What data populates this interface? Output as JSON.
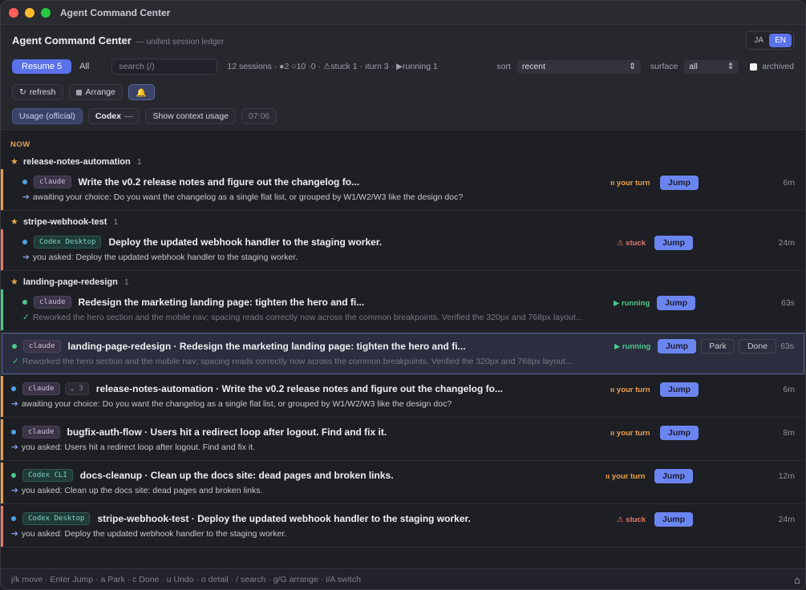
{
  "window": {
    "title": "Agent Command Center"
  },
  "header": {
    "app_name": "Agent Command Center",
    "app_sub": "— unified session ledger",
    "lang": [
      "JA",
      "EN"
    ],
    "resume_label": "Resume 5",
    "all_label": "All",
    "search_placeholder": "search (/)",
    "stats": "12 sessions · ●2 ○10 ·0 · ⚠stuck 1 · ıturn 3 · ▶running 1",
    "sort_label": "sort",
    "sort_value": "recent",
    "surface_label": "surface",
    "surface_value": "all",
    "archived_label": "archived",
    "refresh_label": "refresh",
    "arrange_label": "Arrange",
    "usage_label": "Usage (official)",
    "codex_label": "Codex",
    "codex_value": "—",
    "context_label": "Show context usage",
    "time": "07:06"
  },
  "section_label": "NOW",
  "groups": [
    {
      "name": "release-notes-automation",
      "count": "1"
    },
    {
      "name": "stripe-webhook-test",
      "count": "1"
    },
    {
      "name": "landing-page-redesign",
      "count": "1"
    }
  ],
  "items": [
    {
      "badge": "claude",
      "title": "Write the v0.2 release notes and figure out the changelog fo...",
      "status": "ıı your turn",
      "detail": "awaiting your choice: Do you want the changelog as a single flat list, or grouped by W1/W2/W3 like the design doc?",
      "age": "6m"
    },
    {
      "badge": "Codex Desktop",
      "title": "Deploy the updated webhook handler to the staging worker.",
      "status": "⚠ stuck",
      "detail": "you asked: Deploy the updated webhook handler to the staging worker.",
      "age": "24m"
    },
    {
      "badge": "claude",
      "title": "Redesign the marketing landing page: tighten the hero and fi...",
      "status": "▶ running",
      "detail": "Reworked the hero section and the mobile nav; spacing reads correctly now across the common breakpoints. Verified the 320px and 768px layout...",
      "age": "63s"
    },
    {
      "badge": "claude",
      "title": "landing-page-redesign · Redesign the marketing landing page: tighten the hero and fi...",
      "status": "▶ running",
      "detail": "Reworked the hero section and the mobile nav; spacing reads correctly now across the common breakpoints. Verified the 320px and 768px layout...",
      "age": "63s",
      "park": "Park",
      "done": "Done"
    },
    {
      "badge": "claude",
      "count": "3",
      "title": "release-notes-automation · Write the v0.2 release notes and figure out the changelog fo...",
      "status": "ıı your turn",
      "detail": "awaiting your choice: Do you want the changelog as a single flat list, or grouped by W1/W2/W3 like the design doc?",
      "age": "6m"
    },
    {
      "badge": "claude",
      "title": "bugfix-auth-flow · Users hit a redirect loop after logout. Find and fix it.",
      "status": "ıı your turn",
      "detail": "you asked: Users hit a redirect loop after logout. Find and fix it.",
      "age": "8m"
    },
    {
      "badge": "Codex CLI",
      "title": "docs-cleanup · Clean up the docs site: dead pages and broken links.",
      "status": "ıı your turn",
      "detail": "you asked: Clean up the docs site: dead pages and broken links.",
      "age": "12m"
    },
    {
      "badge": "Codex Desktop",
      "title": "stripe-webhook-test · Deploy the updated webhook handler to the staging worker.",
      "status": "⚠ stuck",
      "detail": "you asked: Deploy the updated webhook handler to the staging worker.",
      "age": "24m"
    }
  ],
  "jump_label": "Jump",
  "footer": "j/k move · Enter Jump · a Park · c Done · u Undo · o detail · / search · g/G arrange · i/A switch",
  "colors": {
    "accent": "#5a72e8",
    "your_turn": "#e8a14d",
    "stuck": "#e27a6d",
    "running": "#4bc98a"
  }
}
